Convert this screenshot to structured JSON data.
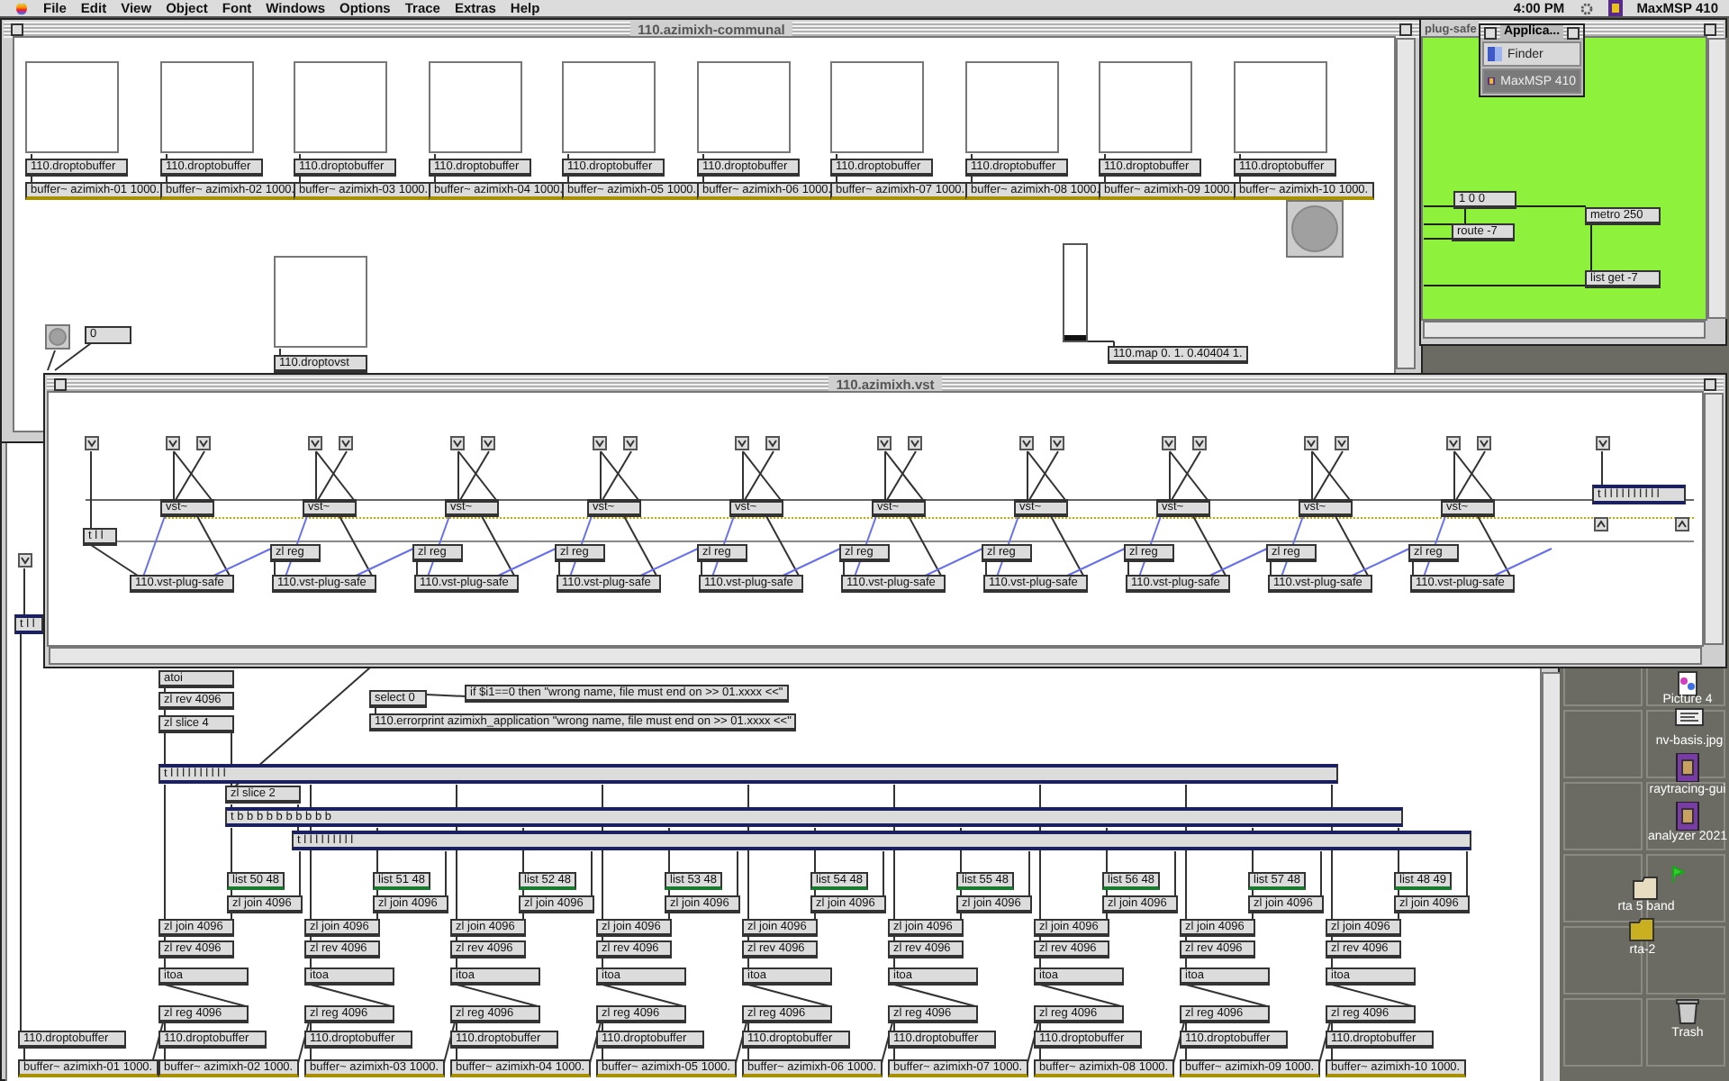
{
  "menubar": {
    "menus": [
      "File",
      "Edit",
      "View",
      "Object",
      "Font",
      "Windows",
      "Options",
      "Trace",
      "Extras",
      "Help"
    ],
    "clock": "4:00 PM",
    "app": "MaxMSP 410"
  },
  "communal": {
    "title": "110.azimixh-communal",
    "drops": [
      {
        "label": "110.droptobuffer",
        "buffer": "buffer~ azimixh-01 1000."
      },
      {
        "label": "110.droptobuffer",
        "buffer": "buffer~ azimixh-02 1000."
      },
      {
        "label": "110.droptobuffer",
        "buffer": "buffer~ azimixh-03 1000."
      },
      {
        "label": "110.droptobuffer",
        "buffer": "buffer~ azimixh-04 1000."
      },
      {
        "label": "110.droptobuffer",
        "buffer": "buffer~ azimixh-05 1000."
      },
      {
        "label": "110.droptobuffer",
        "buffer": "buffer~ azimixh-06 1000."
      },
      {
        "label": "110.droptobuffer",
        "buffer": "buffer~ azimixh-07 1000."
      },
      {
        "label": "110.droptobuffer",
        "buffer": "buffer~ azimixh-08 1000."
      },
      {
        "label": "110.droptobuffer",
        "buffer": "buffer~ azimixh-09 1000."
      },
      {
        "label": "110.droptobuffer",
        "buffer": "buffer~ azimixh-10 1000."
      }
    ],
    "number": "0",
    "vst_drop": "110.droptovst",
    "slider": {
      "level": 0
    },
    "map": "110.map 0. 1. 0.40404 1."
  },
  "plug_window": {
    "title": "plug-safe",
    "objects": [
      {
        "kind": "object",
        "text": "1 0 0"
      },
      {
        "kind": "object",
        "text": "route -7"
      },
      {
        "kind": "object",
        "text": "metro 250"
      },
      {
        "kind": "object",
        "text": "list get -7"
      }
    ]
  },
  "app_menu": {
    "title": "Applica...",
    "items": [
      {
        "label": "Finder",
        "selected": false
      },
      {
        "label": "MaxMSP 410",
        "selected": true
      }
    ]
  },
  "vst_window": {
    "title": "110.azimixh.vst",
    "left_trigger": "t l l",
    "right_trigger": "t l l l l l l l l l l",
    "channels": [
      {
        "plugin": "vst~",
        "safe": "110.vst-plug-safe"
      },
      {
        "plugin": "vst~",
        "safe": "110.vst-plug-safe",
        "reg": "zl reg"
      },
      {
        "plugin": "vst~",
        "safe": "110.vst-plug-safe",
        "reg": "zl reg"
      },
      {
        "plugin": "vst~",
        "safe": "110.vst-plug-safe",
        "reg": "zl reg"
      },
      {
        "plugin": "vst~",
        "safe": "110.vst-plug-safe",
        "reg": "zl reg"
      },
      {
        "plugin": "vst~",
        "safe": "110.vst-plug-safe",
        "reg": "zl reg"
      },
      {
        "plugin": "vst~",
        "safe": "110.vst-plug-safe",
        "reg": "zl reg"
      },
      {
        "plugin": "vst~",
        "safe": "110.vst-plug-safe",
        "reg": "zl reg"
      },
      {
        "plugin": "vst~",
        "safe": "110.vst-plug-safe",
        "reg": "zl reg"
      },
      {
        "plugin": "vst~",
        "safe": "110.vst-plug-safe",
        "reg": "zl reg"
      }
    ]
  },
  "patcher": {
    "left_trigger": "t l l",
    "objects": [
      {
        "kind": "object",
        "text": "atoi"
      },
      {
        "kind": "object",
        "text": "zl rev 4096"
      },
      {
        "kind": "object",
        "text": "zl slice 4"
      },
      {
        "kind": "object",
        "text": "select 0"
      },
      {
        "kind": "object",
        "text": "if $i1==0 then \"wrong name, file must end on >> 01.xxxx <<\""
      },
      {
        "kind": "object",
        "text": "110.errorprint azimixh_application \"wrong name, file must end on >> 01.xxxx <<\""
      },
      {
        "kind": "trigger",
        "text": "t l l l l l l l l l l"
      },
      {
        "kind": "object",
        "text": "zl slice 2"
      },
      {
        "kind": "trigger",
        "text": "t b b b b b b b b b b"
      },
      {
        "kind": "trigger",
        "text": "t l l l l l l l l l"
      }
    ],
    "first": {
      "drop": "110.droptobuffer",
      "buffer": "buffer~ azimixh-01 1000."
    },
    "columns": [
      {
        "list": "list 50 48",
        "join_upper": "zl join 4096",
        "join": "zl join 4096",
        "rev": "zl rev 4096",
        "itoa": "itoa",
        "reg": "zl reg 4096",
        "drop": "110.droptobuffer",
        "buffer": "buffer~ azimixh-02 1000."
      },
      {
        "list": "list 51 48",
        "join_upper": "zl join 4096",
        "join": "zl join 4096",
        "rev": "zl rev 4096",
        "itoa": "itoa",
        "reg": "zl reg 4096",
        "drop": "110.droptobuffer",
        "buffer": "buffer~ azimixh-03 1000."
      },
      {
        "list": "list 52 48",
        "join_upper": "zl join 4096",
        "join": "zl join 4096",
        "rev": "zl rev 4096",
        "itoa": "itoa",
        "reg": "zl reg 4096",
        "drop": "110.droptobuffer",
        "buffer": "buffer~ azimixh-04 1000."
      },
      {
        "list": "list 53 48",
        "join_upper": "zl join 4096",
        "join": "zl join 4096",
        "rev": "zl rev 4096",
        "itoa": "itoa",
        "reg": "zl reg 4096",
        "drop": "110.droptobuffer",
        "buffer": "buffer~ azimixh-05 1000."
      },
      {
        "list": "list 54 48",
        "join_upper": "zl join 4096",
        "join": "zl join 4096",
        "rev": "zl rev 4096",
        "itoa": "itoa",
        "reg": "zl reg 4096",
        "drop": "110.droptobuffer",
        "buffer": "buffer~ azimixh-06 1000."
      },
      {
        "list": "list 55 48",
        "join_upper": "zl join 4096",
        "join": "zl join 4096",
        "rev": "zl rev 4096",
        "itoa": "itoa",
        "reg": "zl reg 4096",
        "drop": "110.droptobuffer",
        "buffer": "buffer~ azimixh-07 1000."
      },
      {
        "list": "list 56 48",
        "join_upper": "zl join 4096",
        "join": "zl join 4096",
        "rev": "zl rev 4096",
        "itoa": "itoa",
        "reg": "zl reg 4096",
        "drop": "110.droptobuffer",
        "buffer": "buffer~ azimixh-08 1000."
      },
      {
        "list": "list 57 48",
        "join_upper": "zl join 4096",
        "join": "zl join 4096",
        "rev": "zl rev 4096",
        "itoa": "itoa",
        "reg": "zl reg 4096",
        "drop": "110.droptobuffer",
        "buffer": "buffer~ azimixh-09 1000."
      },
      {
        "list": "list 48 49",
        "join_upper": "zl join 4096",
        "join": "zl join 4096",
        "rev": "zl rev 4096",
        "itoa": "itoa",
        "reg": "zl reg 4096",
        "drop": "110.droptobuffer",
        "buffer": "buffer~ azimixh-10 1000."
      }
    ]
  },
  "desktop": {
    "icons": [
      {
        "kind": "picture",
        "label": "Picture 4"
      },
      {
        "kind": "image",
        "label": "nv-basis.jpg"
      },
      {
        "kind": "app",
        "label": "raytracing-gui"
      },
      {
        "kind": "app",
        "label": "analyzer 2021"
      },
      {
        "kind": "folder",
        "label": "rta 5 band"
      },
      {
        "kind": "folder",
        "label": "rta-2"
      },
      {
        "kind": "trash",
        "label": "Trash"
      }
    ]
  }
}
